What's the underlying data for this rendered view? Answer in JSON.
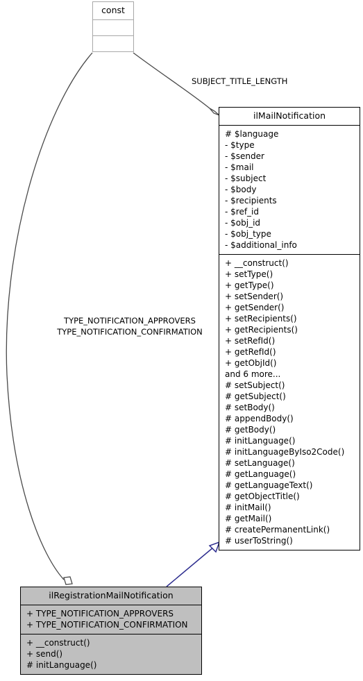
{
  "diagram": {
    "type": "uml-class-diagram",
    "title": "ilRegistrationMailNotification class hierarchy",
    "background_color": "#ffffff",
    "line_color": "#4a4a4a",
    "inheritance_color": "#2e2e8f",
    "node_fill_highlight": "#bfbfbf"
  },
  "nodes": {
    "const_node": {
      "name": "const",
      "attributes": [],
      "methods": [],
      "style": "plain"
    },
    "il_mail_notification": {
      "name": "ilMailNotification",
      "attributes": [
        "# $language",
        "- $type",
        "- $sender",
        "- $mail",
        "- $subject",
        "- $body",
        "- $recipients",
        "- $ref_id",
        "- $obj_id",
        "- $obj_type",
        "- $additional_info"
      ],
      "methods": [
        "+ __construct()",
        "+ setType()",
        "+ getType()",
        "+ setSender()",
        "+ getSender()",
        "+ setRecipients()",
        "+ getRecipients()",
        "+ setRefId()",
        "+ getRefId()",
        "+ getObjId()",
        "and 6 more...",
        "# setSubject()",
        "# getSubject()",
        "# setBody()",
        "# appendBody()",
        "# getBody()",
        "# initLanguage()",
        "# initLanguageByIso2Code()",
        "# setLanguage()",
        "# getLanguage()",
        "# getLanguageText()",
        "# getObjectTitle()",
        "# initMail()",
        "# getMail()",
        "# createPermanentLink()",
        "# userToString()"
      ],
      "style": "default"
    },
    "il_registration_mail_notification": {
      "name": "ilRegistrationMailNotification",
      "attributes": [
        "+ TYPE_NOTIFICATION_APPROVERS",
        "+ TYPE_NOTIFICATION_CONFIRMATION"
      ],
      "methods": [
        "+ __construct()",
        "+ send()",
        "# initLanguage()"
      ],
      "style": "filled"
    }
  },
  "edges": [
    {
      "id": "const-to-mail-notification",
      "from": "const_node",
      "to": "il_mail_notification",
      "relation": "aggregation",
      "label": "SUBJECT_TITLE_LENGTH"
    },
    {
      "id": "const-to-registration-notification",
      "from": "const_node",
      "to": "il_registration_mail_notification",
      "relation": "aggregation",
      "label_line_1": "TYPE_NOTIFICATION_APPROVERS",
      "label_line_2": "TYPE_NOTIFICATION_CONFIRMATION"
    },
    {
      "id": "registration-inherits-mail-notification",
      "from": "il_registration_mail_notification",
      "to": "il_mail_notification",
      "relation": "inheritance",
      "label": ""
    }
  ]
}
